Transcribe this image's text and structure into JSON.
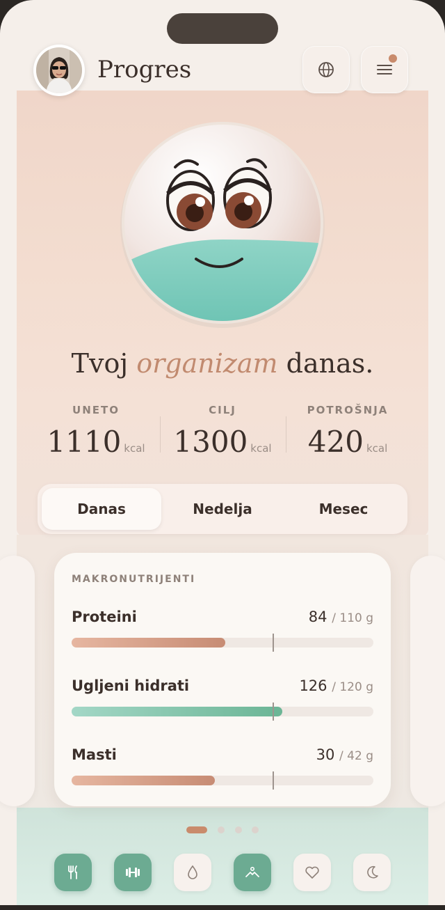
{
  "header": {
    "title": "Progres"
  },
  "headline": {
    "pre": "Tvoj ",
    "emphasis": "organizam",
    "post": " danas."
  },
  "stats": [
    {
      "label": "UNETO",
      "value": "1110",
      "unit": "kcal"
    },
    {
      "label": "CILJ",
      "value": "1300",
      "unit": "kcal"
    },
    {
      "label": "POTROŠNJA",
      "value": "420",
      "unit": "kcal"
    }
  ],
  "tabs": [
    {
      "label": "Danas",
      "active": true
    },
    {
      "label": "Nedelja",
      "active": false
    },
    {
      "label": "Mesec",
      "active": false
    }
  ],
  "macros": {
    "title": "MAKRONUTRIJENTI",
    "items": [
      {
        "name": "Proteini",
        "value": "84",
        "target": "/ 110 g",
        "current": 84,
        "goal": 110,
        "color": "warm"
      },
      {
        "name": "Ugljeni hidrati",
        "value": "126",
        "target": "/ 120 g",
        "current": 126,
        "goal": 120,
        "color": "green"
      },
      {
        "name": "Masti",
        "value": "30",
        "target": "/ 42 g",
        "current": 30,
        "goal": 42,
        "color": "warm"
      }
    ]
  },
  "pager": {
    "count": 4,
    "active": 0
  },
  "bottom_nav": [
    {
      "icon": "fork-knife-icon",
      "active": true
    },
    {
      "icon": "dumbbell-icon",
      "active": true
    },
    {
      "icon": "water-drop-icon",
      "active": false
    },
    {
      "icon": "mountain-person-icon",
      "active": true
    },
    {
      "icon": "heart-icon",
      "active": false
    },
    {
      "icon": "moon-icon",
      "active": false
    }
  ],
  "colors": {
    "accent": "#c98b6c",
    "mint": "#6cab92",
    "text": "#3b2f2a"
  }
}
